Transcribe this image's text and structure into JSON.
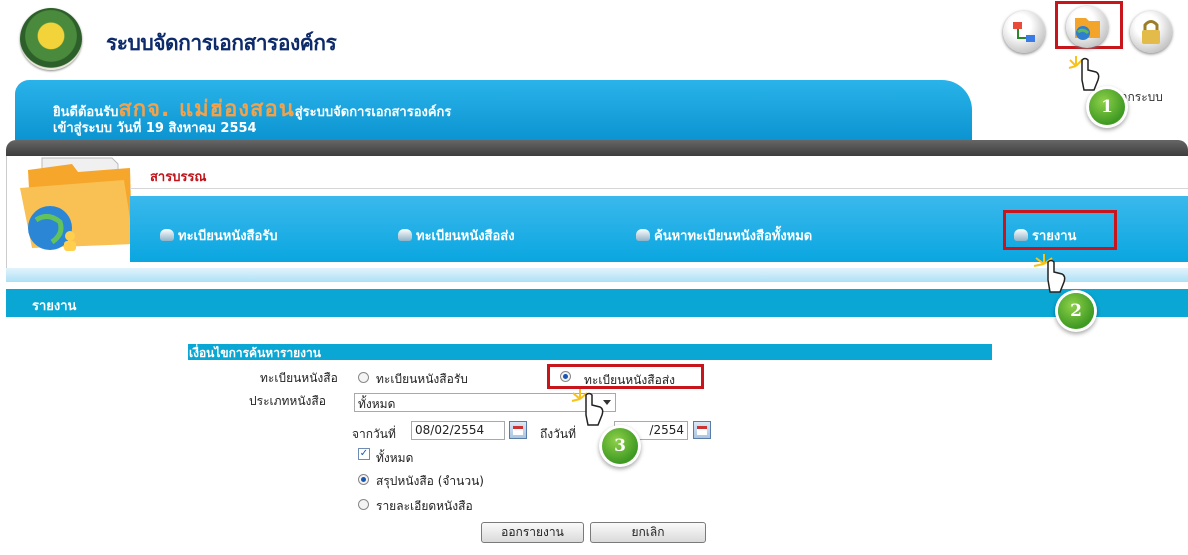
{
  "header": {
    "app_title": "ระบบจัดการเอกสารองค์กร",
    "toolbar_icons": [
      "workflow-icon",
      "folder-globe-icon",
      "lock-icon"
    ],
    "logout_label": "าากระบบ"
  },
  "welcome": {
    "prefix": "ยินดีต้อนรับ",
    "org": "สกจ. แม่ฮ่องสอน",
    "suffix": "สู่ระบบจัดการเอกสารองค์กร",
    "login_line": "เข้าสู่ระบบ วันที่ 19 สิงหาคม 2554"
  },
  "module": {
    "title": "สารบรรณ",
    "nav": [
      {
        "label": "ทะเบียนหนังสือรับ"
      },
      {
        "label": "ทะเบียนหนังสือส่ง"
      },
      {
        "label": "ค้นหาทะเบียนหนังสือทั้งหมด"
      },
      {
        "label": "รายงาน"
      }
    ]
  },
  "section": {
    "title": "รายงาน"
  },
  "form": {
    "header": "เงื่อนไขการค้นหารายงาน",
    "register_label": "ทะเบียนหนังสือ",
    "register_options": [
      {
        "label": "ทะเบียนหนังสือรับ",
        "selected": false
      },
      {
        "label": "ทะเบียนหนังสือส่ง",
        "selected": true
      }
    ],
    "doc_type_label": "ประเภทหนังสือ",
    "doc_type_value": "ทั้งหมด",
    "from_label": "จากวันที่",
    "from_value": "08/02/2554",
    "to_label": "ถึงวันที่",
    "to_value": "/2554",
    "all_checkbox_label": "ทั้งหมด",
    "all_checked": true,
    "mode_options": [
      {
        "label": "สรุปหนังสือ (จำนวน)",
        "selected": true
      },
      {
        "label": "รายละเอียดหนังสือ",
        "selected": false
      }
    ],
    "submit_label": "ออกรายงาน",
    "cancel_label": "ยกเลิก"
  },
  "steps": [
    "1",
    "2",
    "3"
  ],
  "colors": {
    "accent": "#0aa7d4",
    "highlight": "#c8141b",
    "title": "#0d2a6b",
    "step": "#4aa52a"
  }
}
